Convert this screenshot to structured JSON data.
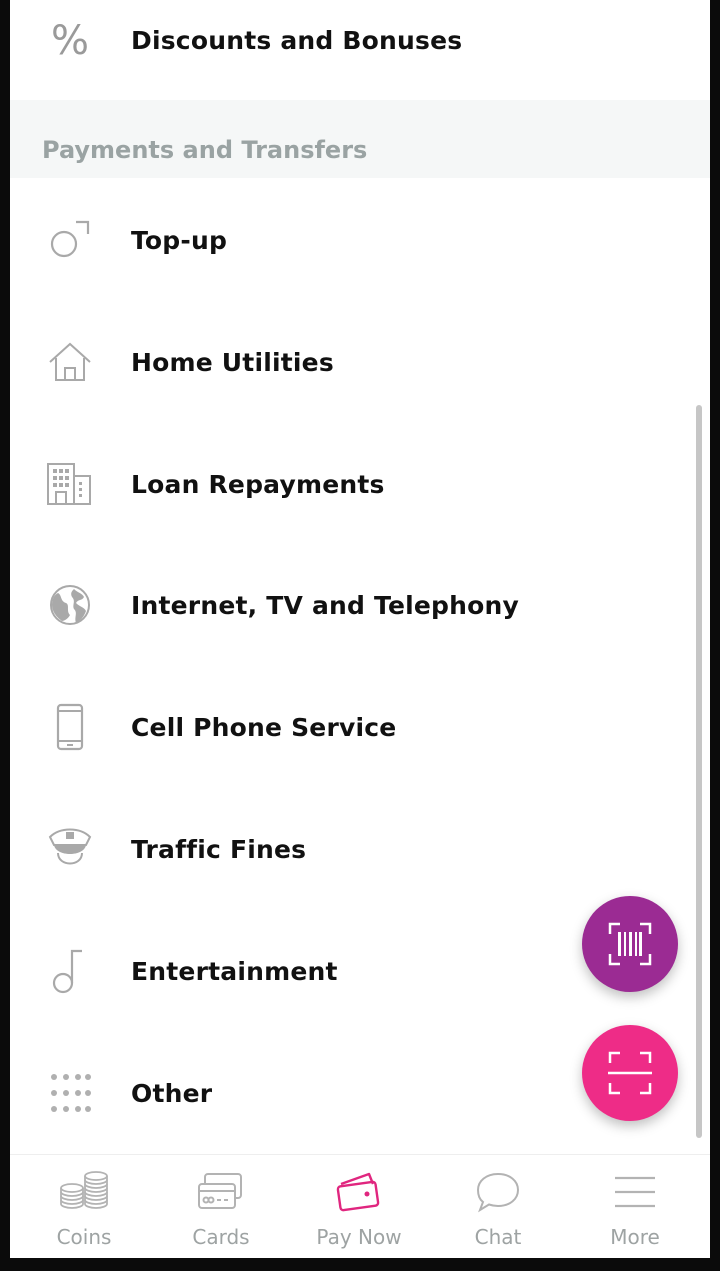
{
  "discounts": {
    "label": "Discounts and Bonuses",
    "icon": "percent-icon"
  },
  "section": {
    "title": "Payments and Transfers"
  },
  "items": [
    {
      "label": "Top-up",
      "icon": "top-up-icon"
    },
    {
      "label": "Home Utilities",
      "icon": "home-icon"
    },
    {
      "label": "Loan Repayments",
      "icon": "building-icon"
    },
    {
      "label": "Internet, TV and Telephony",
      "icon": "globe-icon"
    },
    {
      "label": "Cell Phone Service",
      "icon": "phone-icon"
    },
    {
      "label": "Traffic Fines",
      "icon": "police-cap-icon"
    },
    {
      "label": "Entertainment",
      "icon": "music-note-icon"
    },
    {
      "label": "Other",
      "icon": "dots-grid-icon"
    }
  ],
  "fabs": {
    "barcode": {
      "icon": "barcode-icon",
      "color": "#9b2b93"
    },
    "scan": {
      "icon": "scan-icon",
      "color": "#ee2c87"
    }
  },
  "nav": [
    {
      "label": "Coins",
      "icon": "coins-icon",
      "active": false
    },
    {
      "label": "Cards",
      "icon": "cards-icon",
      "active": false
    },
    {
      "label": "Pay Now",
      "icon": "wallet-icon",
      "active": true
    },
    {
      "label": "Chat",
      "icon": "chat-icon",
      "active": false
    },
    {
      "label": "More",
      "icon": "menu-icon",
      "active": false
    }
  ],
  "colors": {
    "accent": "#e0267f",
    "icon_gray": "#a9a9a9",
    "section_bg": "#f5f7f7"
  }
}
